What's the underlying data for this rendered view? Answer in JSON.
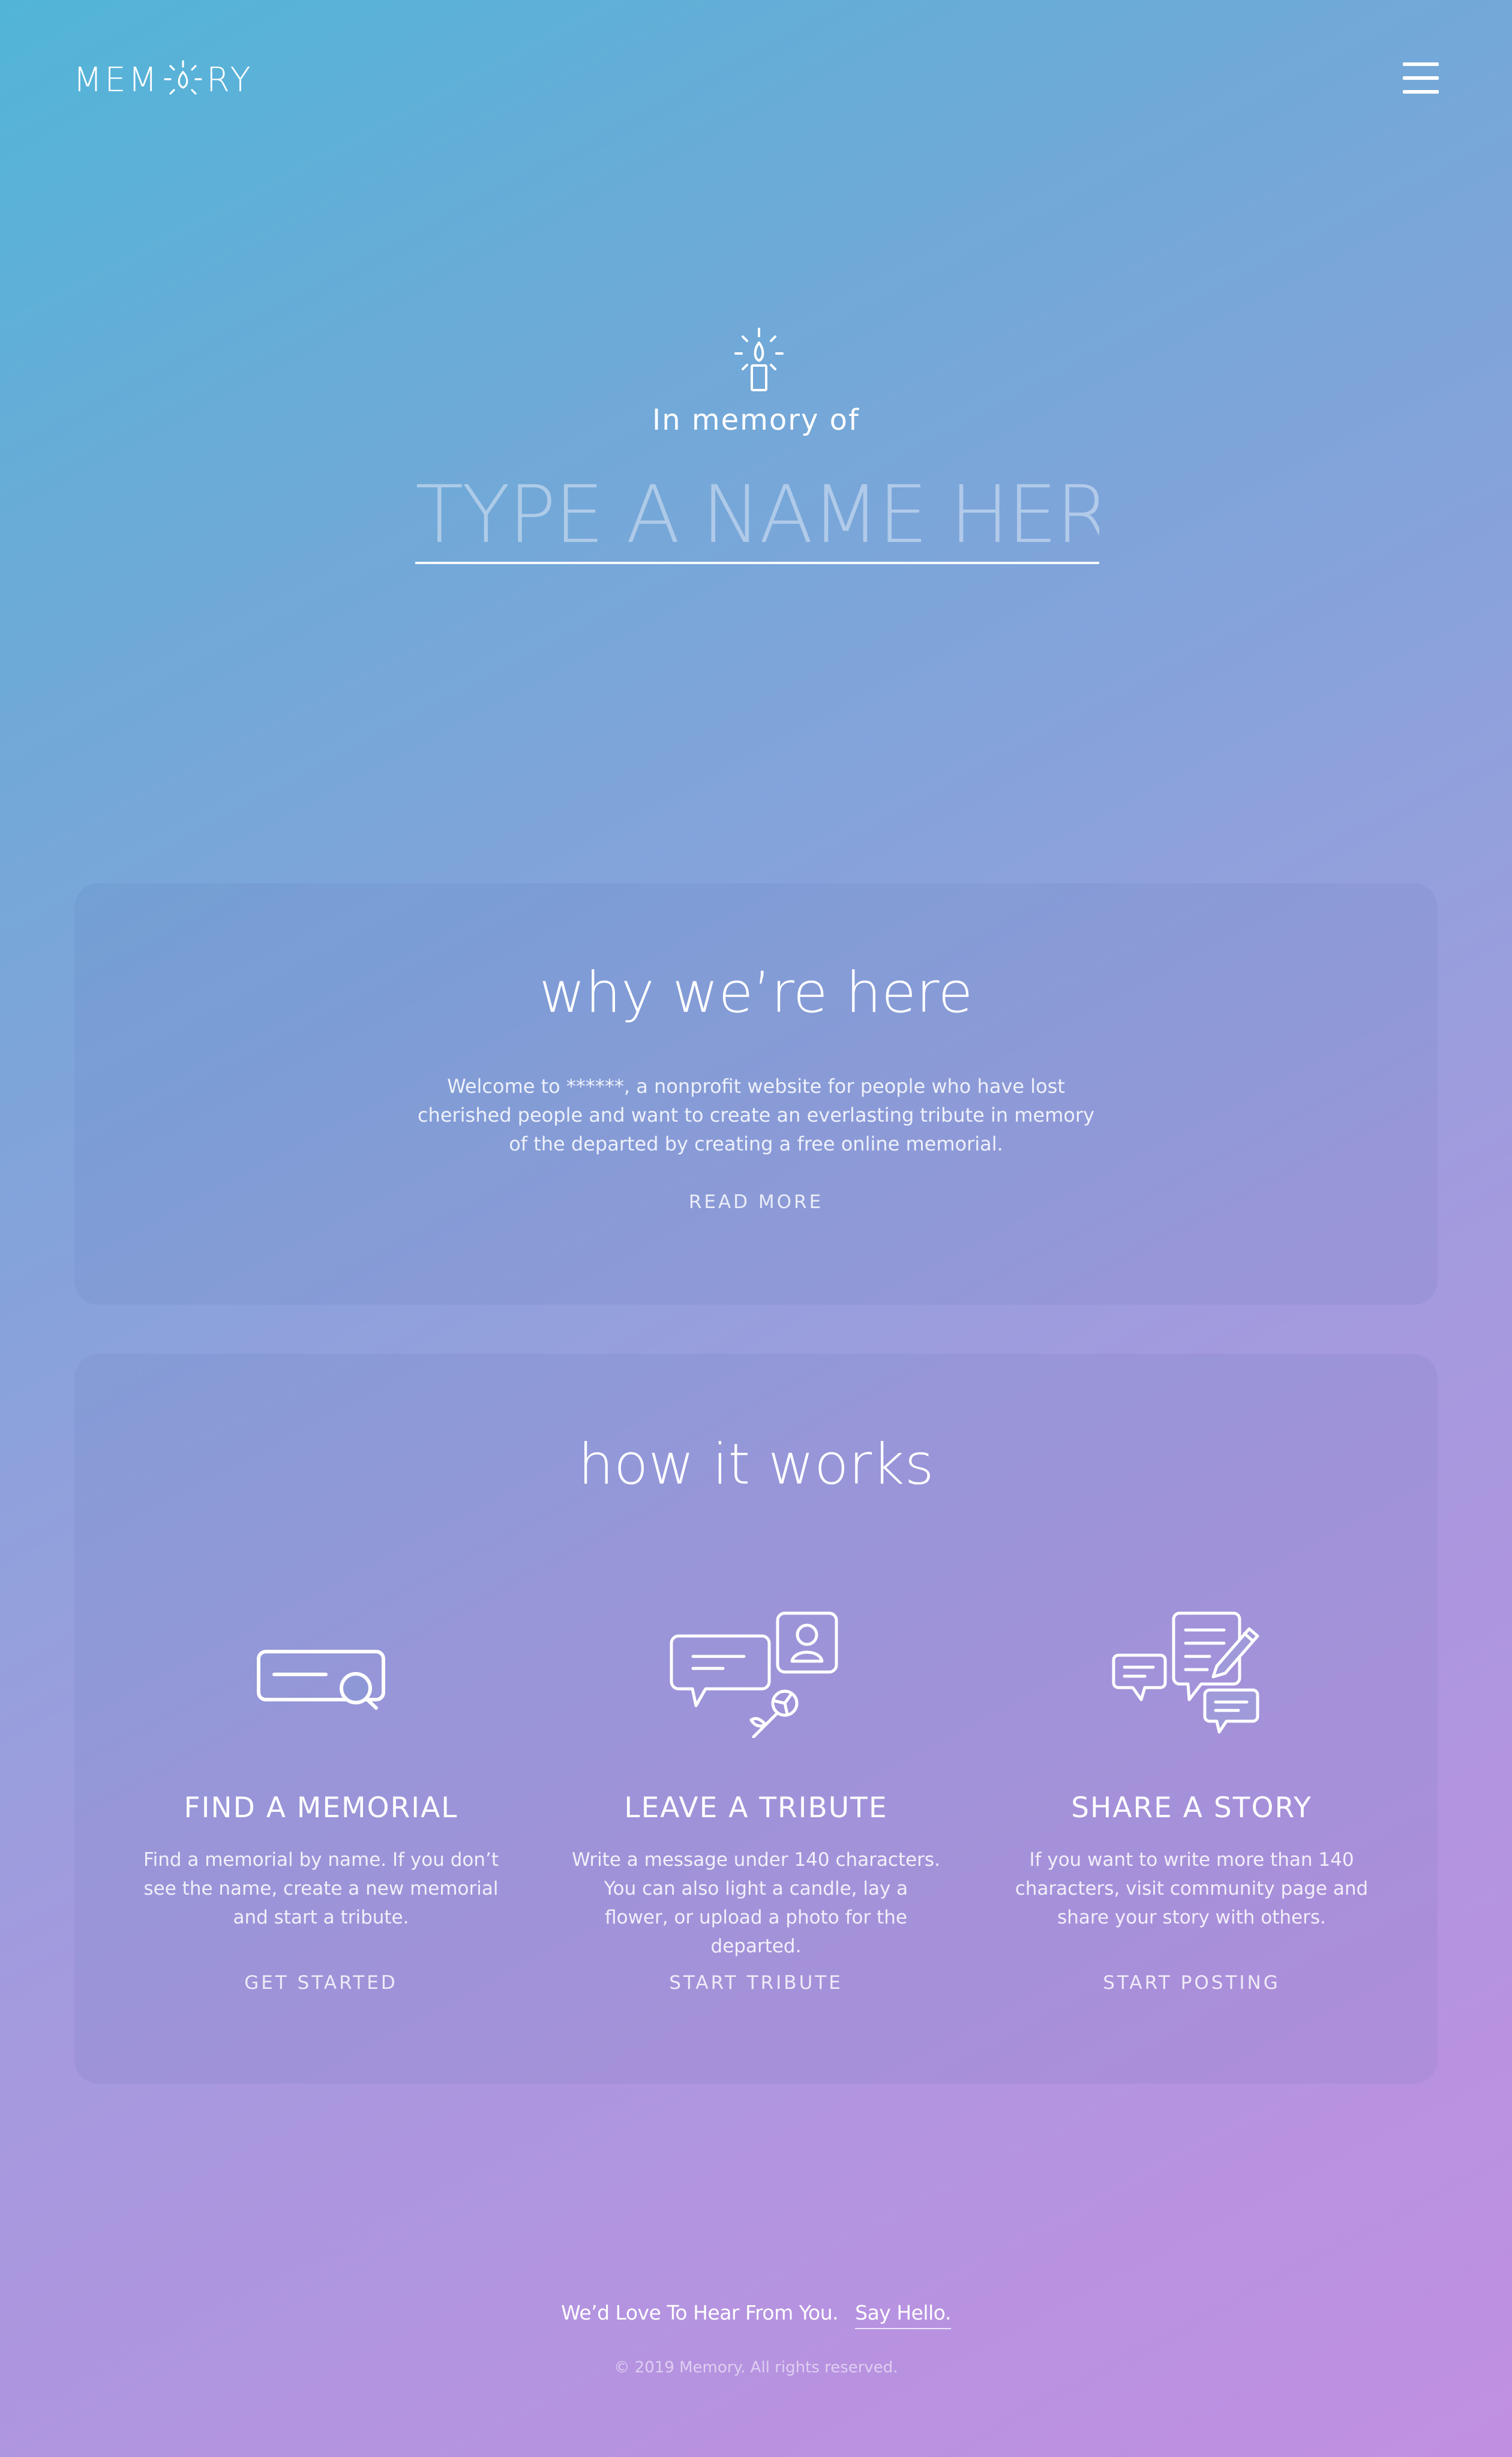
{
  "header": {
    "logo_prefix": "MEM",
    "logo_suffix": "RY",
    "logo_icon": "candle-flame-logo-icon",
    "menu_icon": "hamburger-menu-icon"
  },
  "hero": {
    "candle_icon": "candle-icon",
    "subtitle": "In memory of",
    "name_placeholder": "TYPE A NAME HERE",
    "name_value": ""
  },
  "why": {
    "title": "why we’re here",
    "text": "Welcome to ******, a nonprofit website for people who have lost cherished people and want to create an everlasting tribute in memory of the departed by creating a free online memorial.",
    "link": "READ MORE"
  },
  "how": {
    "title": "how it works",
    "features": [
      {
        "icon": "search-memorial-icon",
        "title": "FIND A MEMORIAL",
        "text": "Find a memorial by name. If you don’t see the name, create a new memorial and start a tribute.",
        "link": "GET STARTED"
      },
      {
        "icon": "tribute-messages-icon",
        "title": "LEAVE A TRIBUTE",
        "text": "Write a message under 140 characters. You can also light a candle, lay a flower, or upload a photo for the departed.",
        "link": "START TRIBUTE"
      },
      {
        "icon": "share-story-icon",
        "title": "SHARE A STORY",
        "text": "If you want to write more than 140 characters, visit community page and share your story with others.",
        "link": "START POSTING"
      }
    ]
  },
  "footer": {
    "message": "We’d Love To Hear From You.",
    "link": "Say Hello.",
    "copyright": "© 2019 Memory. All rights reserved."
  }
}
